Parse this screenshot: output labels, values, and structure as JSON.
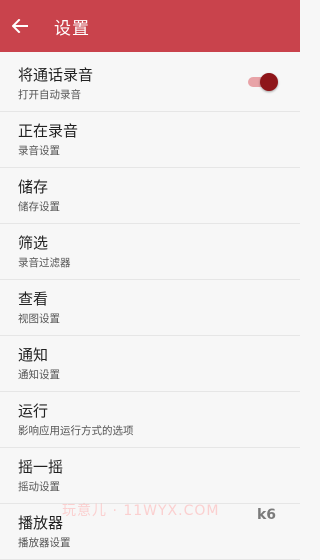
{
  "app_bar": {
    "title": "设置",
    "back_icon": "arrow-left-icon"
  },
  "colors": {
    "primary": "#c9434c",
    "toggle_on": "#8e1519"
  },
  "items": [
    {
      "title": "将通话录音",
      "subtitle": "打开自动录音",
      "toggle": true
    },
    {
      "title": "正在录音",
      "subtitle": "录音设置"
    },
    {
      "title": "储存",
      "subtitle": "储存设置"
    },
    {
      "title": "筛选",
      "subtitle": "录音过滤器"
    },
    {
      "title": "查看",
      "subtitle": "视图设置"
    },
    {
      "title": "通知",
      "subtitle": "通知设置"
    },
    {
      "title": "运行",
      "subtitle": "影响应用运行方式的选项"
    },
    {
      "title": "摇一摇",
      "subtitle": "摇动设置"
    },
    {
      "title": "播放器",
      "subtitle": "播放器设置"
    }
  ],
  "watermark": "玩意儿 · 11WYX.COM",
  "logo_mark": "k6"
}
